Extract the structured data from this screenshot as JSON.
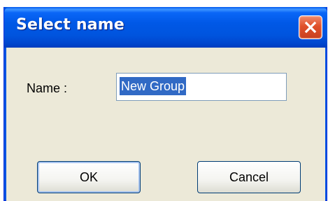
{
  "dialog": {
    "title": "Select name",
    "name_label": "Name :",
    "name_value": "New Group",
    "ok_label": "OK",
    "cancel_label": "Cancel"
  },
  "colors": {
    "titlebar": "#0054e3",
    "client_background": "#ece9d8",
    "close_button": "#e0502a",
    "selection": "#316ac5"
  },
  "icons": {
    "close": "close-icon"
  }
}
